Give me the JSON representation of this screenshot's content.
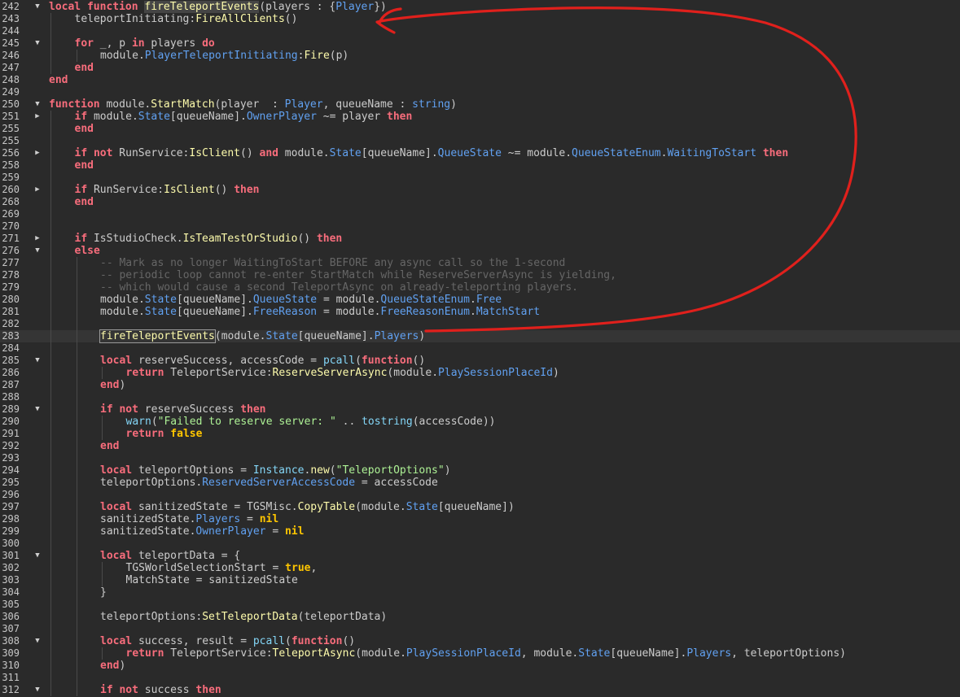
{
  "editor": {
    "cursor_line": "283",
    "lines": [
      {
        "n": "242",
        "fold": "▼",
        "indent": 0,
        "tokens": [
          [
            "kw",
            "local"
          ],
          [
            "op",
            " "
          ],
          [
            "kw",
            "function"
          ],
          [
            "op",
            " "
          ],
          [
            "fn hl",
            "fireTeleportEvents"
          ],
          [
            "op",
            "(players : {"
          ],
          [
            "pr",
            "Player"
          ],
          [
            "op",
            "})"
          ]
        ]
      },
      {
        "n": "243",
        "fold": "",
        "indent": 1,
        "tokens": [
          [
            "op",
            "teleportInitiating:"
          ],
          [
            "fn",
            "FireAllClients"
          ],
          [
            "op",
            "()"
          ]
        ]
      },
      {
        "n": "244",
        "fold": "",
        "indent": 0,
        "tokens": []
      },
      {
        "n": "245",
        "fold": "▼",
        "indent": 1,
        "tokens": [
          [
            "kw",
            "for"
          ],
          [
            "op",
            " _, p "
          ],
          [
            "kw",
            "in"
          ],
          [
            "op",
            " players "
          ],
          [
            "kw",
            "do"
          ]
        ]
      },
      {
        "n": "246",
        "fold": "",
        "indent": 2,
        "tokens": [
          [
            "op",
            "module."
          ],
          [
            "pr",
            "PlayerTeleportInitiating"
          ],
          [
            "op",
            ":"
          ],
          [
            "fn",
            "Fire"
          ],
          [
            "op",
            "(p)"
          ]
        ]
      },
      {
        "n": "247",
        "fold": "",
        "indent": 1,
        "tokens": [
          [
            "kw",
            "end"
          ]
        ]
      },
      {
        "n": "248",
        "fold": "",
        "indent": 0,
        "tokens": [
          [
            "kw",
            "end"
          ]
        ]
      },
      {
        "n": "249",
        "fold": "",
        "indent": 0,
        "tokens": []
      },
      {
        "n": "250",
        "fold": "▼",
        "indent": 0,
        "tokens": [
          [
            "kw",
            "function"
          ],
          [
            "op",
            " module."
          ],
          [
            "fn",
            "StartMatch"
          ],
          [
            "op",
            "(player  : "
          ],
          [
            "pr",
            "Player"
          ],
          [
            "op",
            ", queueName : "
          ],
          [
            "pr",
            "string"
          ],
          [
            "op",
            ")"
          ]
        ]
      },
      {
        "n": "251",
        "fold": "▶",
        "indent": 1,
        "tokens": [
          [
            "kw",
            "if"
          ],
          [
            "op",
            " module."
          ],
          [
            "pr",
            "State"
          ],
          [
            "op",
            "[queueName]."
          ],
          [
            "pr",
            "OwnerPlayer"
          ],
          [
            "op",
            " ~= player "
          ],
          [
            "kw",
            "then"
          ]
        ]
      },
      {
        "n": "255",
        "fold": "",
        "indent": 1,
        "tokens": [
          [
            "kw",
            "end"
          ]
        ]
      },
      {
        "n": "255",
        "fold": "",
        "indent": 0,
        "tokens": []
      },
      {
        "n": "256",
        "fold": "▶",
        "indent": 1,
        "tokens": [
          [
            "kw",
            "if"
          ],
          [
            "op",
            " "
          ],
          [
            "kw",
            "not"
          ],
          [
            "op",
            " RunService:"
          ],
          [
            "fn",
            "IsClient"
          ],
          [
            "op",
            "() "
          ],
          [
            "kw",
            "and"
          ],
          [
            "op",
            " module."
          ],
          [
            "pr",
            "State"
          ],
          [
            "op",
            "[queueName]."
          ],
          [
            "pr",
            "QueueState"
          ],
          [
            "op",
            " ~= module."
          ],
          [
            "pr",
            "QueueStateEnum"
          ],
          [
            "op",
            "."
          ],
          [
            "pr",
            "WaitingToStart"
          ],
          [
            "op",
            " "
          ],
          [
            "kw",
            "then"
          ]
        ]
      },
      {
        "n": "258",
        "fold": "",
        "indent": 1,
        "tokens": [
          [
            "kw",
            "end"
          ]
        ]
      },
      {
        "n": "259",
        "fold": "",
        "indent": 0,
        "tokens": []
      },
      {
        "n": "260",
        "fold": "▶",
        "indent": 1,
        "tokens": [
          [
            "kw",
            "if"
          ],
          [
            "op",
            " RunService:"
          ],
          [
            "fn",
            "IsClient"
          ],
          [
            "op",
            "() "
          ],
          [
            "kw",
            "then"
          ]
        ]
      },
      {
        "n": "268",
        "fold": "",
        "indent": 1,
        "tokens": [
          [
            "kw",
            "end"
          ]
        ]
      },
      {
        "n": "269",
        "fold": "",
        "indent": 0,
        "tokens": []
      },
      {
        "n": "270",
        "fold": "",
        "indent": 0,
        "tokens": []
      },
      {
        "n": "271",
        "fold": "▶",
        "indent": 1,
        "tokens": [
          [
            "kw",
            "if"
          ],
          [
            "op",
            " IsStudioCheck."
          ],
          [
            "fn",
            "IsTeamTestOrStudio"
          ],
          [
            "op",
            "() "
          ],
          [
            "kw",
            "then"
          ]
        ]
      },
      {
        "n": "276",
        "fold": "▼",
        "indent": 1,
        "tokens": [
          [
            "kw",
            "else"
          ]
        ]
      },
      {
        "n": "277",
        "fold": "",
        "indent": 2,
        "tokens": [
          [
            "cm",
            "-- Mark as no longer WaitingToStart BEFORE any async call so the 1-second"
          ]
        ]
      },
      {
        "n": "278",
        "fold": "",
        "indent": 2,
        "tokens": [
          [
            "cm",
            "-- periodic loop cannot re-enter StartMatch while ReserveServerAsync is yielding,"
          ]
        ]
      },
      {
        "n": "279",
        "fold": "",
        "indent": 2,
        "tokens": [
          [
            "cm",
            "-- which would cause a second TeleportAsync on already-teleporting players."
          ]
        ]
      },
      {
        "n": "280",
        "fold": "",
        "indent": 2,
        "tokens": [
          [
            "op",
            "module."
          ],
          [
            "pr",
            "State"
          ],
          [
            "op",
            "[queueName]."
          ],
          [
            "pr",
            "QueueState"
          ],
          [
            "op",
            " = module."
          ],
          [
            "pr",
            "QueueStateEnum"
          ],
          [
            "op",
            "."
          ],
          [
            "pr",
            "Free"
          ]
        ]
      },
      {
        "n": "281",
        "fold": "",
        "indent": 2,
        "tokens": [
          [
            "op",
            "module."
          ],
          [
            "pr",
            "State"
          ],
          [
            "op",
            "[queueName]."
          ],
          [
            "pr",
            "FreeReason"
          ],
          [
            "op",
            " = module."
          ],
          [
            "pr",
            "FreeReasonEnum"
          ],
          [
            "op",
            "."
          ],
          [
            "pr",
            "MatchStart"
          ]
        ]
      },
      {
        "n": "282",
        "fold": "",
        "indent": 0,
        "tokens": []
      },
      {
        "n": "283",
        "fold": "",
        "indent": 2,
        "tokens": [
          [
            "fn box",
            "fireTeleportEvents"
          ],
          [
            "op",
            "(module."
          ],
          [
            "pr",
            "State"
          ],
          [
            "op",
            "[queueName]."
          ],
          [
            "pr",
            "Players"
          ],
          [
            "op",
            ")"
          ]
        ]
      },
      {
        "n": "284",
        "fold": "",
        "indent": 0,
        "tokens": []
      },
      {
        "n": "285",
        "fold": "▼",
        "indent": 2,
        "tokens": [
          [
            "kw",
            "local"
          ],
          [
            "op",
            " reserveSuccess, accessCode = "
          ],
          [
            "bi",
            "pcall"
          ],
          [
            "op",
            "("
          ],
          [
            "kw",
            "function"
          ],
          [
            "op",
            "()"
          ]
        ]
      },
      {
        "n": "286",
        "fold": "",
        "indent": 3,
        "tokens": [
          [
            "kw",
            "return"
          ],
          [
            "op",
            " TeleportService:"
          ],
          [
            "fn",
            "ReserveServerAsync"
          ],
          [
            "op",
            "(module."
          ],
          [
            "pr",
            "PlaySessionPlaceId"
          ],
          [
            "op",
            ")"
          ]
        ]
      },
      {
        "n": "287",
        "fold": "",
        "indent": 2,
        "tokens": [
          [
            "kw",
            "end"
          ],
          [
            "op",
            ")"
          ]
        ]
      },
      {
        "n": "288",
        "fold": "",
        "indent": 0,
        "tokens": []
      },
      {
        "n": "289",
        "fold": "▼",
        "indent": 2,
        "tokens": [
          [
            "kw",
            "if"
          ],
          [
            "op",
            " "
          ],
          [
            "kw",
            "not"
          ],
          [
            "op",
            " reserveSuccess "
          ],
          [
            "kw",
            "then"
          ]
        ]
      },
      {
        "n": "290",
        "fold": "",
        "indent": 3,
        "tokens": [
          [
            "bi",
            "warn"
          ],
          [
            "op",
            "("
          ],
          [
            "st",
            "\"Failed to reserve server: \""
          ],
          [
            "op",
            " .. "
          ],
          [
            "bi",
            "tostring"
          ],
          [
            "op",
            "(accessCode))"
          ]
        ]
      },
      {
        "n": "291",
        "fold": "",
        "indent": 3,
        "tokens": [
          [
            "kw",
            "return"
          ],
          [
            "op",
            " "
          ],
          [
            "kw2",
            "false"
          ]
        ]
      },
      {
        "n": "292",
        "fold": "",
        "indent": 2,
        "tokens": [
          [
            "kw",
            "end"
          ]
        ]
      },
      {
        "n": "293",
        "fold": "",
        "indent": 0,
        "tokens": []
      },
      {
        "n": "294",
        "fold": "",
        "indent": 2,
        "tokens": [
          [
            "kw",
            "local"
          ],
          [
            "op",
            " teleportOptions = "
          ],
          [
            "bi",
            "Instance"
          ],
          [
            "op",
            "."
          ],
          [
            "fn",
            "new"
          ],
          [
            "op",
            "("
          ],
          [
            "st",
            "\"TeleportOptions\""
          ],
          [
            "op",
            ")"
          ]
        ]
      },
      {
        "n": "295",
        "fold": "",
        "indent": 2,
        "tokens": [
          [
            "op",
            "teleportOptions."
          ],
          [
            "pr",
            "ReservedServerAccessCode"
          ],
          [
            "op",
            " = accessCode"
          ]
        ]
      },
      {
        "n": "296",
        "fold": "",
        "indent": 0,
        "tokens": []
      },
      {
        "n": "297",
        "fold": "",
        "indent": 2,
        "tokens": [
          [
            "kw",
            "local"
          ],
          [
            "op",
            " sanitizedState = TGSMisc."
          ],
          [
            "fn",
            "CopyTable"
          ],
          [
            "op",
            "(module."
          ],
          [
            "pr",
            "State"
          ],
          [
            "op",
            "[queueName])"
          ]
        ]
      },
      {
        "n": "298",
        "fold": "",
        "indent": 2,
        "tokens": [
          [
            "op",
            "sanitizedState."
          ],
          [
            "pr",
            "Players"
          ],
          [
            "op",
            " = "
          ],
          [
            "kw2",
            "nil"
          ]
        ]
      },
      {
        "n": "299",
        "fold": "",
        "indent": 2,
        "tokens": [
          [
            "op",
            "sanitizedState."
          ],
          [
            "pr",
            "OwnerPlayer"
          ],
          [
            "op",
            " = "
          ],
          [
            "kw2",
            "nil"
          ]
        ]
      },
      {
        "n": "300",
        "fold": "",
        "indent": 0,
        "tokens": []
      },
      {
        "n": "301",
        "fold": "▼",
        "indent": 2,
        "tokens": [
          [
            "kw",
            "local"
          ],
          [
            "op",
            " teleportData = {"
          ]
        ]
      },
      {
        "n": "302",
        "fold": "",
        "indent": 3,
        "tokens": [
          [
            "op",
            "TGSWorldSelectionStart = "
          ],
          [
            "kw2",
            "true"
          ],
          [
            "op",
            ","
          ]
        ]
      },
      {
        "n": "303",
        "fold": "",
        "indent": 3,
        "tokens": [
          [
            "op",
            "MatchState = sanitizedState"
          ]
        ]
      },
      {
        "n": "304",
        "fold": "",
        "indent": 2,
        "tokens": [
          [
            "op",
            "}"
          ]
        ]
      },
      {
        "n": "305",
        "fold": "",
        "indent": 0,
        "tokens": []
      },
      {
        "n": "306",
        "fold": "",
        "indent": 2,
        "tokens": [
          [
            "op",
            "teleportOptions:"
          ],
          [
            "fn",
            "SetTeleportData"
          ],
          [
            "op",
            "(teleportData)"
          ]
        ]
      },
      {
        "n": "307",
        "fold": "",
        "indent": 0,
        "tokens": []
      },
      {
        "n": "308",
        "fold": "▼",
        "indent": 2,
        "tokens": [
          [
            "kw",
            "local"
          ],
          [
            "op",
            " success, result = "
          ],
          [
            "bi",
            "pcall"
          ],
          [
            "op",
            "("
          ],
          [
            "kw",
            "function"
          ],
          [
            "op",
            "()"
          ]
        ]
      },
      {
        "n": "309",
        "fold": "",
        "indent": 3,
        "tokens": [
          [
            "kw",
            "return"
          ],
          [
            "op",
            " TeleportService:"
          ],
          [
            "fn",
            "TeleportAsync"
          ],
          [
            "op",
            "(module."
          ],
          [
            "pr",
            "PlaySessionPlaceId"
          ],
          [
            "op",
            ", module."
          ],
          [
            "pr",
            "State"
          ],
          [
            "op",
            "[queueName]."
          ],
          [
            "pr",
            "Players"
          ],
          [
            "op",
            ", teleportOptions)"
          ]
        ]
      },
      {
        "n": "310",
        "fold": "",
        "indent": 2,
        "tokens": [
          [
            "kw",
            "end"
          ],
          [
            "op",
            ")"
          ]
        ]
      },
      {
        "n": "311",
        "fold": "",
        "indent": 0,
        "tokens": []
      },
      {
        "n": "312",
        "fold": "▼",
        "indent": 2,
        "tokens": [
          [
            "kw",
            "if"
          ],
          [
            "op",
            " "
          ],
          [
            "kw",
            "not"
          ],
          [
            "op",
            " success "
          ],
          [
            "kw",
            "then"
          ]
        ]
      }
    ]
  },
  "colors": {
    "background": "#2a2a2a",
    "annotation_stroke": "#e0201c"
  }
}
